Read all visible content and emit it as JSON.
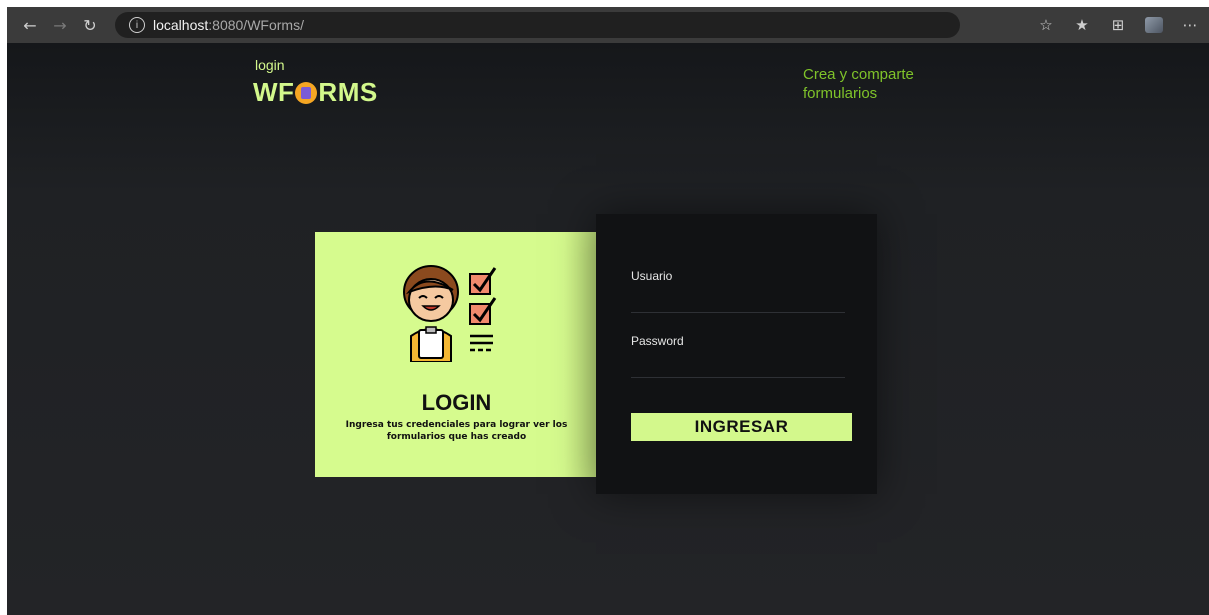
{
  "browser": {
    "url_host": "localhost",
    "url_rest": ":8080/WForms/"
  },
  "header": {
    "nav_login": "login",
    "brand_prefix": "WF",
    "brand_suffix": "RMS",
    "tagline": "Crea y comparte formularios"
  },
  "left_card": {
    "title": "LOGIN",
    "description": "Ingresa tus credenciales para lograr ver los formularios que has creado"
  },
  "form": {
    "username_label": "Usuario",
    "username_value": "",
    "password_label": "Password",
    "password_value": "",
    "submit_label": "INGRESAR"
  },
  "colors": {
    "accent": "#d3f88c",
    "tagline": "#7fc32a",
    "page_bg": "#1f2124",
    "card_dark": "#111214"
  }
}
